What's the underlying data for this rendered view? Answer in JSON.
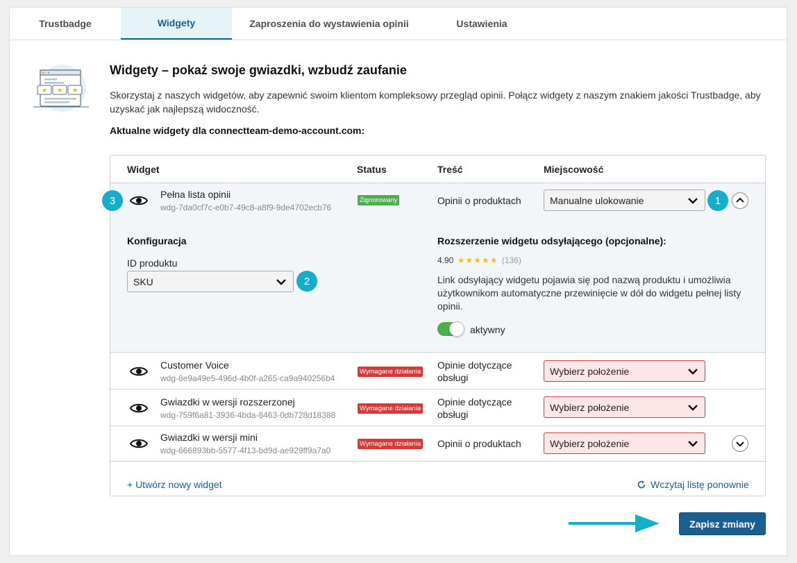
{
  "tabs": [
    {
      "label": "Trustbadge"
    },
    {
      "label": "Widgety"
    },
    {
      "label": "Zaproszenia do wystawienia opinii"
    },
    {
      "label": "Ustawienia"
    }
  ],
  "header": {
    "title": "Widgety – pokaż swoje gwiazdki, wzbudź zaufanie",
    "intro": "Skorzystaj z naszych widgetów, aby zapewnić swoim klientom kompleksowy przegląd opinii. Połącz widgety z naszym znakiem jakości Trustbadge, aby uzyskać jak najlepszą widoczność.",
    "current_label": "Aktualne widgety dla connectteam-demo-account.com:"
  },
  "table": {
    "columns": {
      "widget": "Widget",
      "status": "Status",
      "content": "Treść",
      "location": "Miejscowość"
    },
    "rows": [
      {
        "name": "Pełna lista opinii",
        "id": "wdg-7da0cf7c-e0b7-49c8-a8f9-9de4702ecb76",
        "status": "Zignorowany",
        "content": "Opinii o produktach",
        "location": "Manualne ulokowanie"
      },
      {
        "name": "Customer Voice",
        "id": "wdg-8e9a49e5-496d-4b0f-a265-ca9a940256b4",
        "status": "Wymagane działania",
        "content": "Opinie dotyczące obsługi",
        "location": "Wybierz położenie"
      },
      {
        "name": "Gwiazdki w wersji rozszerzonej",
        "id": "wdg-759f6a81-3936-4bda-8463-0db728d18388",
        "status": "Wymagane działania",
        "content": "Opinie dotyczące obsługi",
        "location": "Wybierz położenie"
      },
      {
        "name": "Gwiazdki w wersji mini",
        "id": "wdg-666893bb-5577-4f13-bd9d-ae929ff9a7a0",
        "status": "Wymagane działania",
        "content": "Opinii o produktach",
        "location": "Wybierz położenie"
      }
    ],
    "config": {
      "title": "Konfiguracja",
      "product_id_label": "ID produktu",
      "product_id_value": "SKU"
    },
    "extension": {
      "title": "Rozszerzenie widgetu odsyłającego (opcjonalne):",
      "rating": "4.90",
      "stars": "★★★★★",
      "count": "(136)",
      "description": "Link odsyłający widgetu pojawia się pod nazwą produktu i umożliwia użytkownikom automatyczne przewinięcie w dół do widgetu pełnej listy opinii.",
      "toggle_label": "aktywny",
      "toggle_on": true
    },
    "footer": {
      "create": "+ Utwórz nowy widget",
      "reload": "Wczytaj listę ponownie"
    }
  },
  "markers": [
    "1",
    "2",
    "3"
  ],
  "save_label": "Zapisz zmiany",
  "colors": {
    "accent": "#1a5f92",
    "marker": "#14aecb",
    "ignored": "#4cae4c",
    "required": "#d9383a"
  }
}
